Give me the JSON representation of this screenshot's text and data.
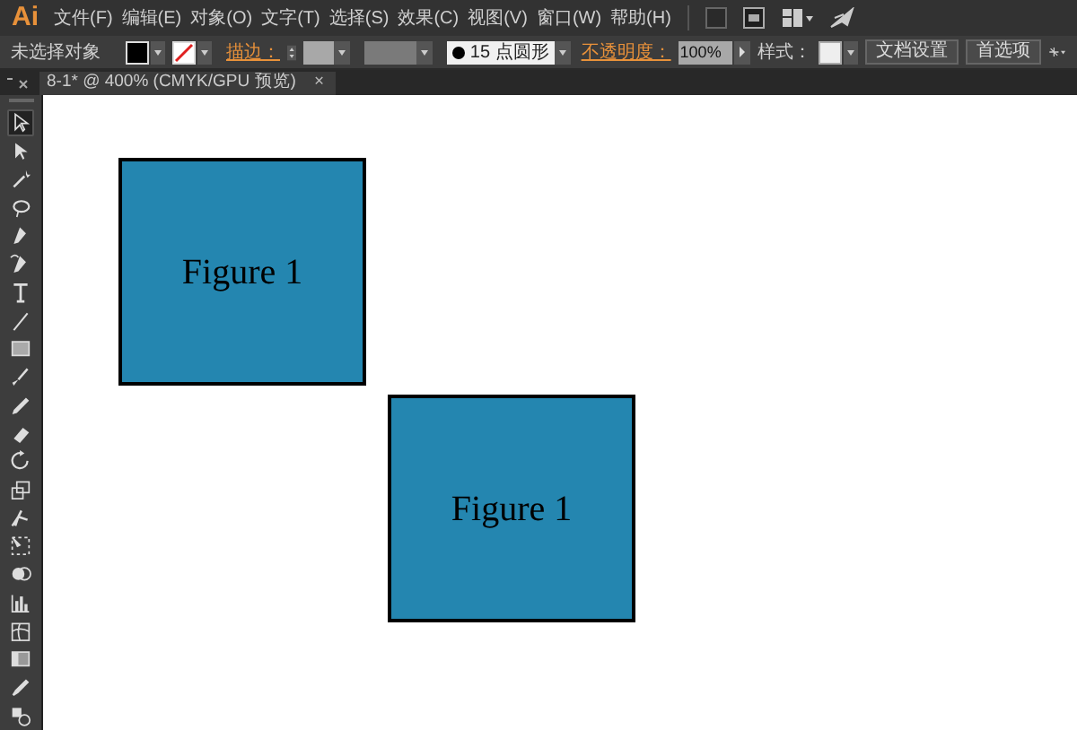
{
  "app": {
    "logo": "Ai"
  },
  "menu": [
    "文件(F)",
    "编辑(E)",
    "对象(O)",
    "文字(T)",
    "选择(S)",
    "效果(C)",
    "视图(V)",
    "窗口(W)",
    "帮助(H)"
  ],
  "control_bar": {
    "selection_label": "未选择对象",
    "stroke_link": "描边：",
    "brush": "15 点圆形",
    "opacity_link": "不透明度：",
    "opacity": "100%",
    "style_label": "样式：",
    "buttons": [
      "文档设置",
      "首选项"
    ]
  },
  "document_tab": {
    "title": "8-1* @ 400% (CMYK/GPU 预览)",
    "close": "×"
  },
  "tools": [
    {
      "kind": "selection",
      "selected": true
    },
    {
      "kind": "direct-selection",
      "selected": false
    },
    {
      "kind": "magic-wand",
      "selected": false
    },
    {
      "kind": "lasso",
      "selected": false
    },
    {
      "kind": "pen",
      "selected": false
    },
    {
      "kind": "curvature",
      "selected": false
    },
    {
      "kind": "type",
      "selected": false
    },
    {
      "kind": "line",
      "selected": false
    },
    {
      "kind": "rectangle",
      "selected": false
    },
    {
      "kind": "paintbrush",
      "selected": false
    },
    {
      "kind": "pencil",
      "selected": false
    },
    {
      "kind": "eraser",
      "selected": false
    },
    {
      "kind": "rotate",
      "selected": false
    },
    {
      "kind": "scale",
      "selected": false
    },
    {
      "kind": "warp",
      "selected": false
    },
    {
      "kind": "free-transform",
      "selected": false
    },
    {
      "kind": "shape-builder",
      "selected": false
    },
    {
      "kind": "graph",
      "selected": false
    },
    {
      "kind": "mesh",
      "selected": false
    },
    {
      "kind": "gradient",
      "selected": false
    },
    {
      "kind": "eyedropper",
      "selected": false
    },
    {
      "kind": "blend",
      "selected": false
    }
  ],
  "artboard": [
    {
      "label": "Figure 1",
      "color": "#2486b0"
    },
    {
      "label": "Figure 1",
      "color": "#2486b0"
    }
  ]
}
